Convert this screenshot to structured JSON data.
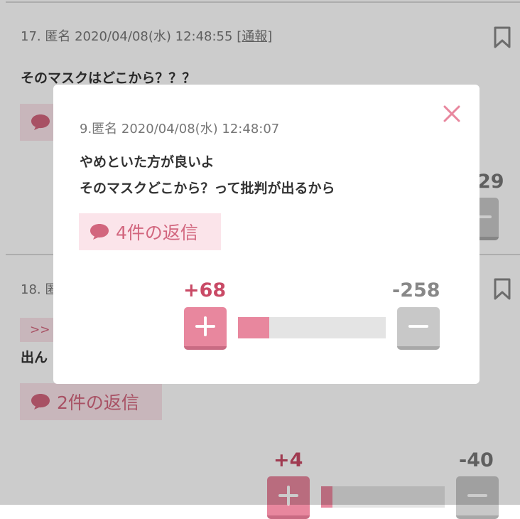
{
  "comments": [
    {
      "number": "17.",
      "name": "匿名",
      "datetime": "2020/04/08(水) 12:48:55",
      "report_label": "[通報]",
      "text": "そのマスクはどこから？？？",
      "vote_minus_partial": "29"
    },
    {
      "number": "18.",
      "name_partial": "匿",
      "quote_partial": ">>",
      "text_partial": "出ん",
      "reply_label": "2件の返信",
      "vote_plus": "+4",
      "vote_minus": "-40",
      "vote_ratio": 0.09
    }
  ],
  "modal": {
    "header": "9.匿名 2020/04/08(水) 12:48:07",
    "lines": [
      "やめといた方が良いよ",
      "そのマスクどこから？って批判が出るから"
    ],
    "reply_label": "4件の返信",
    "vote_plus": "+68",
    "vote_minus": "-258",
    "vote_ratio": 0.21,
    "close_icon": "close-icon"
  },
  "colors": {
    "accent_pink": "#d2667e",
    "plus_button": "#e8879e",
    "minus_button": "#c8c8c8",
    "reply_bg": "#fbe4ea",
    "overlay": "rgba(0,0,0,0.2)"
  }
}
